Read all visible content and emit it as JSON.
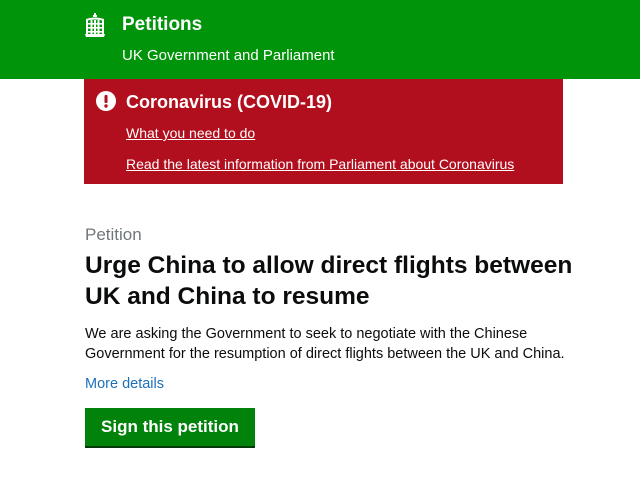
{
  "header": {
    "title": "Petitions",
    "subtitle": "UK Government and Parliament",
    "logo_icon": "portcullis-icon",
    "background_color": "#00940a"
  },
  "alert": {
    "icon": "exclamation-circle-icon",
    "title": "Coronavirus (COVID-19)",
    "links": [
      "What you need to do",
      "Read the latest information from Parliament about Coronavirus"
    ],
    "background_color": "#b10e1e"
  },
  "petition": {
    "caption": "Petition",
    "title": "Urge China to allow direct flights between UK and China to resume",
    "description": "We are asking the Government to seek to negotiate with the Chinese Government for the resumption of direct flights between the UK and China.",
    "more_details_label": "More details",
    "sign_button_label": "Sign this petition",
    "link_color": "#1d70b8",
    "button_color": "#00820b"
  }
}
